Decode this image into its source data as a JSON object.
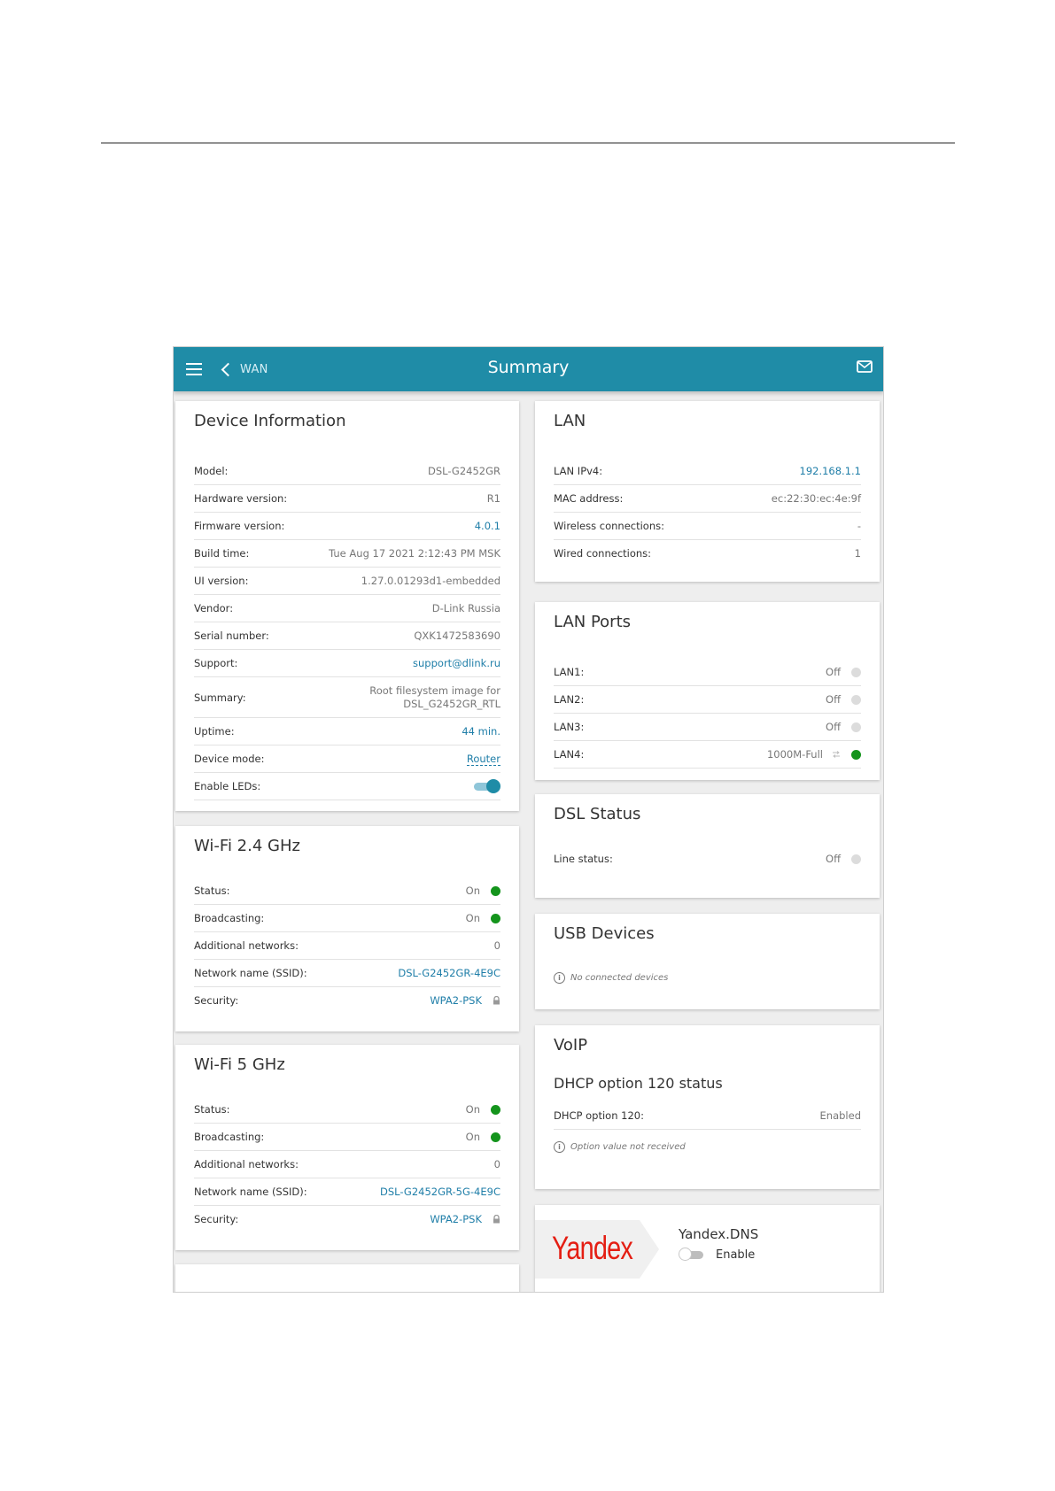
{
  "header": {
    "back_label": "WAN",
    "title": "Summary"
  },
  "device_info": {
    "title": "Device Information",
    "rows": [
      {
        "label": "Model:",
        "value": "DSL-G2452GR"
      },
      {
        "label": "Hardware version:",
        "value": "R1"
      },
      {
        "label": "Firmware version:",
        "value": "4.0.1"
      },
      {
        "label": "Build time:",
        "value": "Tue Aug 17 2021 2:12:43 PM MSK"
      },
      {
        "label": "UI version:",
        "value": "1.27.0.01293d1-embedded"
      },
      {
        "label": "Vendor:",
        "value": "D-Link Russia"
      },
      {
        "label": "Serial number:",
        "value": "QXK1472583690"
      },
      {
        "label": "Support:",
        "value": "support@dlink.ru"
      },
      {
        "label": "Summary:",
        "value_line1": "Root filesystem image for",
        "value_line2": "DSL_G2452GR_RTL"
      },
      {
        "label": "Uptime:",
        "value": "44 min."
      },
      {
        "label": "Device mode:",
        "value": "Router"
      },
      {
        "label": "Enable LEDs:",
        "enabled": true
      }
    ]
  },
  "wifi24": {
    "title": "Wi-Fi 2.4 GHz",
    "rows": [
      {
        "label": "Status:",
        "value": "On"
      },
      {
        "label": "Broadcasting:",
        "value": "On"
      },
      {
        "label": "Additional networks:",
        "value": "0"
      },
      {
        "label": "Network name (SSID):",
        "value": "DSL-G2452GR-4E9C"
      },
      {
        "label": "Security:",
        "value": "WPA2-PSK"
      }
    ]
  },
  "wifi5": {
    "title": "Wi-Fi 5 GHz",
    "rows": [
      {
        "label": "Status:",
        "value": "On"
      },
      {
        "label": "Broadcasting:",
        "value": "On"
      },
      {
        "label": "Additional networks:",
        "value": "0"
      },
      {
        "label": "Network name (SSID):",
        "value": "DSL-G2452GR-5G-4E9C"
      },
      {
        "label": "Security:",
        "value": "WPA2-PSK"
      }
    ]
  },
  "lan": {
    "title": "LAN",
    "rows": [
      {
        "label": "LAN IPv4:",
        "value": "192.168.1.1"
      },
      {
        "label": "MAC address:",
        "value": "ec:22:30:ec:4e:9f"
      },
      {
        "label": "Wireless connections:",
        "value": "-"
      },
      {
        "label": "Wired connections:",
        "value": "1"
      }
    ]
  },
  "lan_ports": {
    "title": "LAN Ports",
    "rows": [
      {
        "label": "LAN1:",
        "value": "Off"
      },
      {
        "label": "LAN2:",
        "value": "Off"
      },
      {
        "label": "LAN3:",
        "value": "Off"
      },
      {
        "label": "LAN4:",
        "value": "1000M-Full"
      }
    ]
  },
  "dsl": {
    "title": "DSL Status",
    "rows": [
      {
        "label": "Line status:",
        "value": "Off"
      }
    ]
  },
  "usb": {
    "title": "USB Devices",
    "note": "No connected devices"
  },
  "voip": {
    "title": "VoIP",
    "subtitle": "DHCP option 120 status",
    "rows": [
      {
        "label": "DHCP option 120:",
        "value": "Enabled"
      }
    ],
    "note": "Option value not received"
  },
  "yandex": {
    "logo_text": "Yandex",
    "title": "Yandex.DNS",
    "toggle_label": "Enable"
  },
  "colors": {
    "header": "#1f8ca7",
    "status_on": "#14941c",
    "status_off": "#dcdcdc",
    "link": "#1f7ea8"
  }
}
